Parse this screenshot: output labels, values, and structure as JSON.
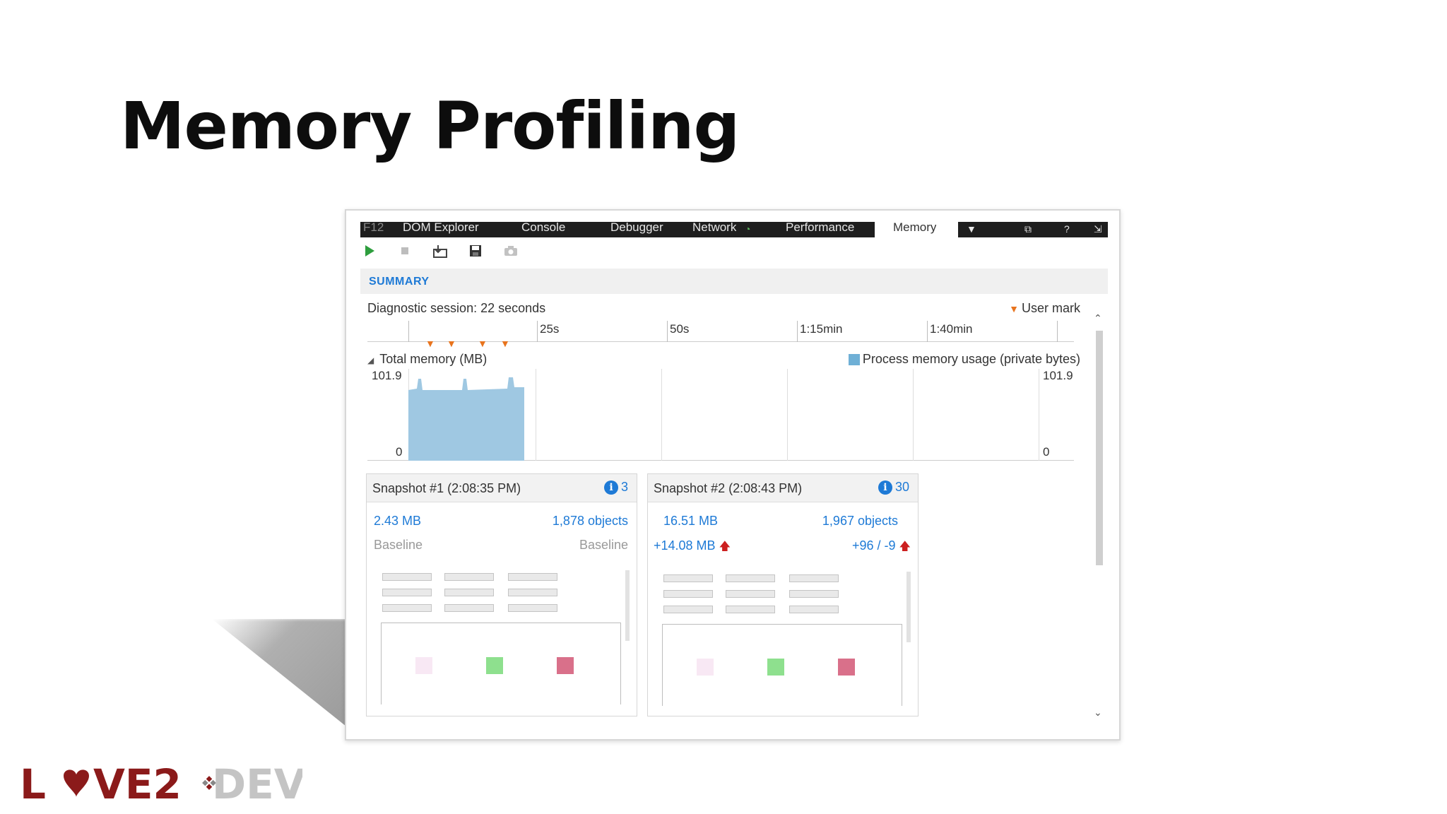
{
  "slide": {
    "title": "Memory Profiling"
  },
  "devtools": {
    "tabs": [
      {
        "label": "F12"
      },
      {
        "label": "DOM Explorer"
      },
      {
        "label": "Console"
      },
      {
        "label": "Debugger"
      },
      {
        "label": "Network"
      },
      {
        "label": "Performance"
      },
      {
        "label": "Memory"
      }
    ],
    "tab_icons": [
      "chevron-down-icon",
      "undock-icon",
      "help-icon",
      "pin-icon"
    ],
    "toolbar": {
      "buttons": [
        "play-icon",
        "stop-icon",
        "import-icon",
        "save-icon",
        "camera-icon"
      ]
    },
    "summary_label": "SUMMARY",
    "session_text": "Diagnostic session: 22 seconds",
    "user_mark_label": "User mark",
    "ruler_labels": [
      "25s",
      "50s",
      "1:15min",
      "1:40min"
    ],
    "total_memory_label": "Total memory (MB)",
    "legend_label": "Process memory usage (private bytes)",
    "y_max_left": "101.9",
    "y_min_left": "0",
    "y_max_right": "101.9",
    "y_min_right": "0",
    "snapshots": [
      {
        "title": "Snapshot #1",
        "time": "(2:08:35 PM)",
        "count": "3",
        "size": "2.43 MB",
        "objects": "1,878 objects",
        "size_diff": "Baseline",
        "objects_diff": "Baseline"
      },
      {
        "title": "Snapshot #2",
        "time": "(2:08:43 PM)",
        "count": "30",
        "size": "16.51 MB",
        "objects": "1,967 objects",
        "size_diff": "+14.08 MB",
        "objects_diff": "+96 / -9"
      }
    ],
    "colors": {
      "accent": "#1e7ad6",
      "memory_fill": "#9fc8e2",
      "marker": "#e8741e",
      "increase": "#cc1f1f"
    }
  },
  "logo": {
    "text_left": "L",
    "text_mid": "VE2",
    "text_right": "DEV",
    "icon": "heart-icon"
  }
}
